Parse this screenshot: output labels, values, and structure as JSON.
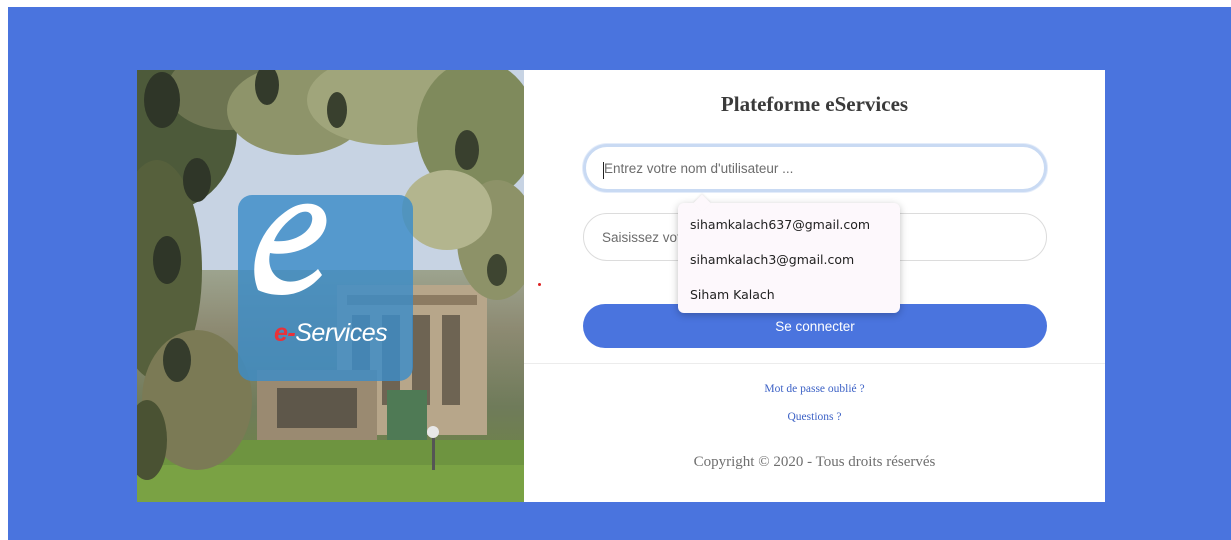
{
  "brand": {
    "logo_text_prefix": "e-",
    "logo_text_suffix": "Services"
  },
  "form": {
    "title": "Plateforme eServices",
    "username_placeholder": "Entrez votre nom d'utilisateur ...",
    "password_placeholder": "Saisissez votre mot de passe ...",
    "login_label": "Se connecter",
    "forgot_password_label": "Mot de passe oublié ?",
    "questions_label": "Questions ?",
    "copyright": "Copyright © 2020 - Tous droits réservés"
  },
  "autocomplete": {
    "items": [
      "sihamkalach637@gmail.com",
      "sihamkalach3@gmail.com",
      "Siham Kalach"
    ]
  },
  "colors": {
    "page_background": "#4a74de",
    "button": "#4a74de",
    "link": "#3d62c6"
  }
}
